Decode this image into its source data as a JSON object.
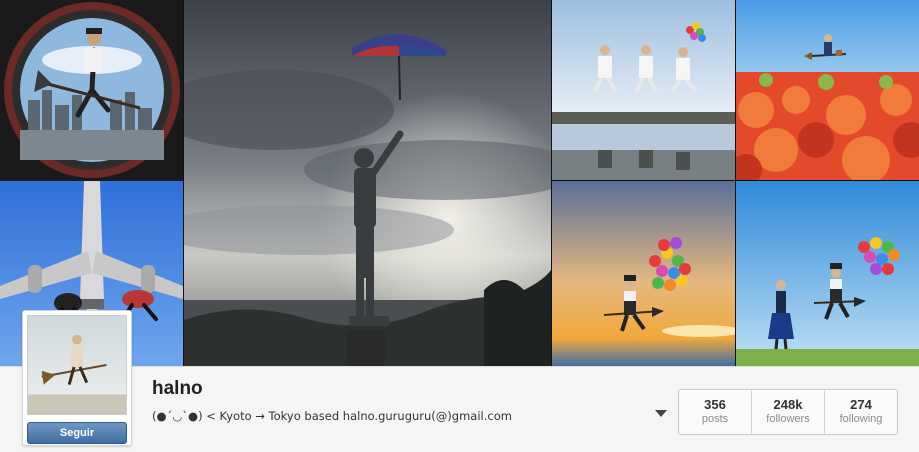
{
  "profile": {
    "username": "halno",
    "bio": "(●´◡`●) < Kyoto → Tokyo based halno.guruguru(@)gmail.com",
    "follow_label": "Seguir"
  },
  "stats": [
    {
      "count": "356",
      "label": "posts"
    },
    {
      "count": "248k",
      "label": "followers"
    },
    {
      "count": "274",
      "label": "following"
    }
  ],
  "menu": {
    "icon": "dropdown-caret-icon"
  },
  "colors": {
    "follow_button": "#4a76a8",
    "page_background": "#f5f5f5",
    "stat_label": "#8a8a8a"
  }
}
